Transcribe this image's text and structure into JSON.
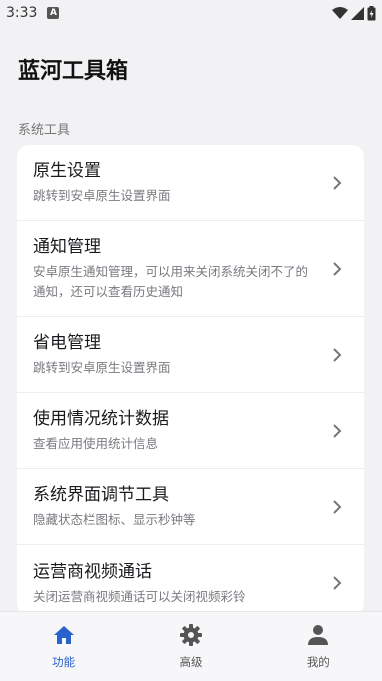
{
  "status_bar": {
    "time": "3:33",
    "notification_icon": "a-icon"
  },
  "app": {
    "title": "蓝河工具箱"
  },
  "section": {
    "label": "系统工具"
  },
  "items": [
    {
      "title": "原生设置",
      "desc": "跳转到安卓原生设置界面"
    },
    {
      "title": "通知管理",
      "desc": "安卓原生通知管理，可以用来关闭系统关闭不了的通知，还可以查看历史通知"
    },
    {
      "title": "省电管理",
      "desc": "跳转到安卓原生设置界面"
    },
    {
      "title": "使用情况统计数据",
      "desc": "查看应用使用统计信息"
    },
    {
      "title": "系统界面调节工具",
      "desc": "隐藏状态栏图标、显示秒钟等"
    },
    {
      "title": "运营商视频通话",
      "desc": "关闭运营商视频通话可以关闭视频彩铃"
    }
  ],
  "nav": [
    {
      "label": "功能",
      "icon": "home-icon",
      "active": true
    },
    {
      "label": "高级",
      "icon": "gear-icon",
      "active": false
    },
    {
      "label": "我的",
      "icon": "person-icon",
      "active": false
    }
  ],
  "colors": {
    "accent": "#2962cc",
    "background": "#f2f2f4",
    "card": "#ffffff"
  }
}
